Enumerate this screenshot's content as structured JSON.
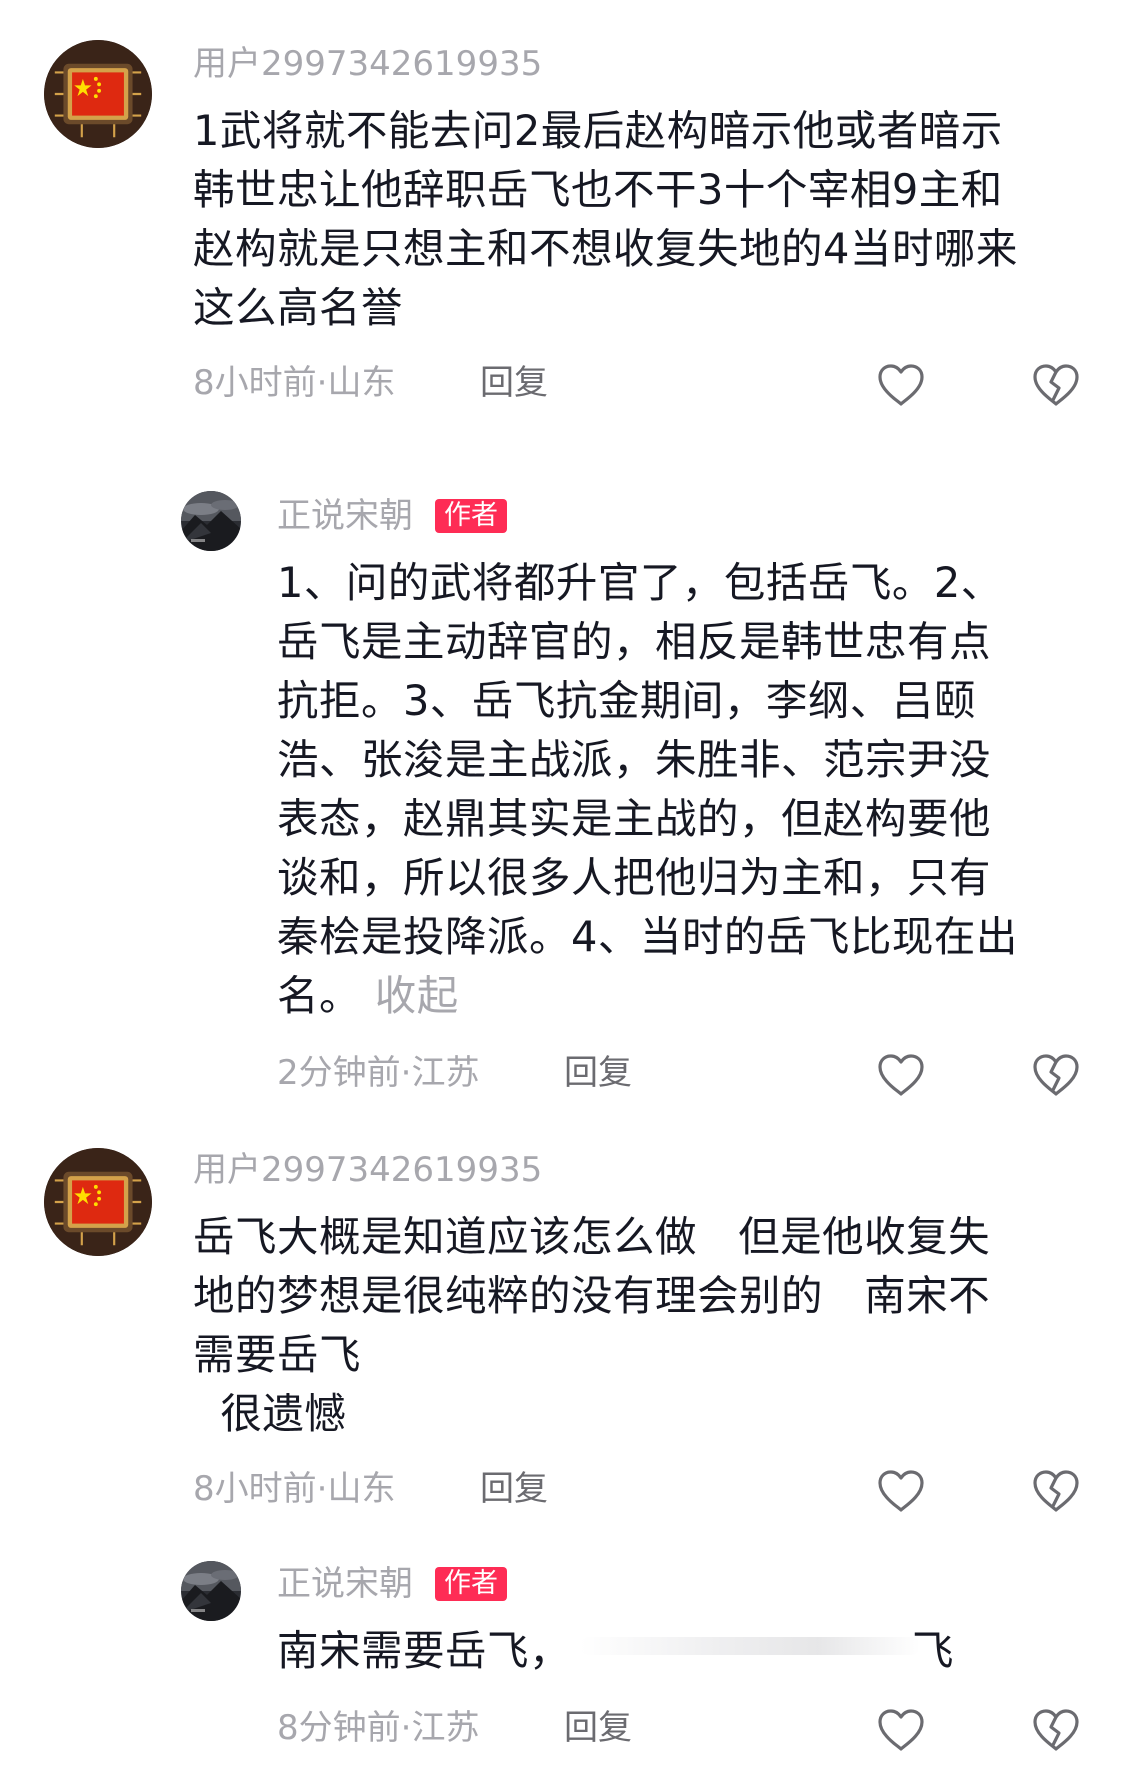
{
  "comments": [
    {
      "username": "用户2997342619935",
      "content": "1武将就不能去问2最后赵构暗示他或者暗示\n韩世忠让他辞职岳飞也不干3十个宰相9主和\n赵构就是只想主和不想收复失地的4当时哪来\n这么高名誉",
      "time_location": "8小时前·山东",
      "reply_label": "回复",
      "avatar_icon": "china-flag-chip-avatar"
    },
    {
      "username": "正说宋朝",
      "badge": "作者",
      "content": "1、问的武将都升官了，包括岳飞。2、\n岳飞是主动辞官的，相反是韩世忠有点\n抗拒。3、岳飞抗金期间，李纲、吕颐\n浩、张浚是主战派，朱胜非、范宗尹没\n表态，赵鼎其实是主战的，但赵构要他\n谈和，所以很多人把他归为主和，只有\n秦桧是投降派。4、当时的岳飞比现在出\n名。",
      "collapse_label": "收起",
      "time_location": "2分钟前·江苏",
      "reply_label": "回复",
      "avatar_icon": "dark-landscape-avatar"
    },
    {
      "username": "用户2997342619935",
      "content": "岳飞大概是知道应该怎么做   但是他收复失\n地的梦想是很纯粹的没有理会别的   南宋不\n需要岳飞\n  很遗憾",
      "time_location": "8小时前·山东",
      "reply_label": "回复",
      "avatar_icon": "china-flag-chip-avatar"
    },
    {
      "username": "正说宋朝",
      "badge": "作者",
      "content_start": "南宋需要岳飞，",
      "content_end": "飞",
      "time_location": "8分钟前·江苏",
      "reply_label": "回复",
      "avatar_icon": "dark-landscape-avatar"
    }
  ],
  "icons": {
    "like": "heart-outline-icon",
    "dislike": "broken-heart-outline-icon"
  },
  "colors": {
    "text": "#161823",
    "muted": "#a7a7ad",
    "reply": "#6b6b70",
    "badge": "#fe2c55"
  }
}
